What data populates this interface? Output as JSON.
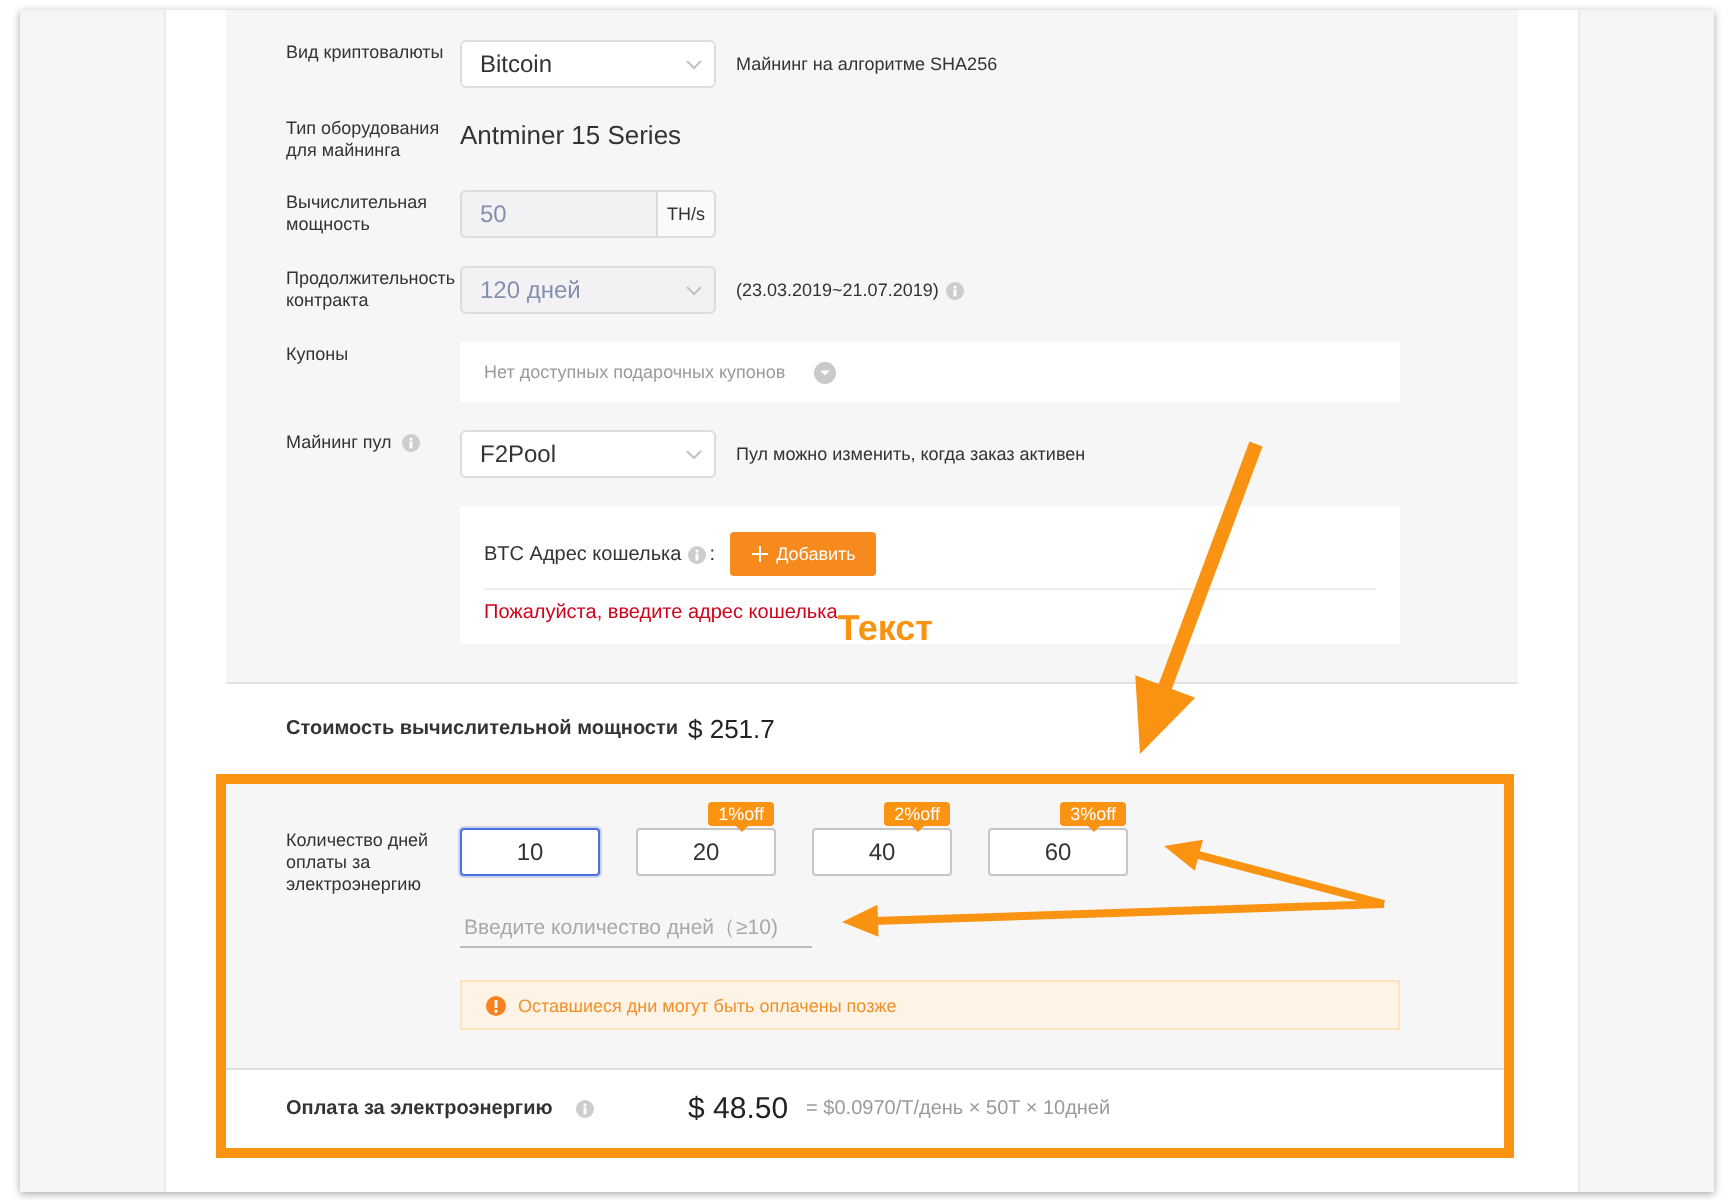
{
  "form_fields": [
    {
      "kind": "select",
      "label": "Вид криптовалюты",
      "value": "Bitcoin",
      "disabled": false,
      "note": "Майнинг на алгоритме SHA256"
    },
    {
      "kind": "text",
      "label": "Тип оборудования для майнинга",
      "value": "Antminer 15 Series"
    },
    {
      "kind": "unit_input",
      "label": "Вычислительная мощность",
      "value": "50",
      "unit": "TH/s",
      "disabled": true
    },
    {
      "kind": "select",
      "label": "Продолжительность контракта",
      "value": "120 дней",
      "disabled": true,
      "note": "(23.03.2019~21.07.2019)",
      "note_info": true
    },
    {
      "kind": "coupon",
      "label": "Купоны",
      "placeholder": "Нет доступных подарочных купонов"
    },
    {
      "kind": "select",
      "label": "Майнинг пул",
      "label_info": true,
      "value": "F2Pool",
      "disabled": false,
      "note": "Пул можно изменить, когда заказ активен"
    }
  ],
  "wallet": {
    "label": "BTC Адрес кошелька",
    "info": true,
    "separator": ":",
    "button": "Добавить",
    "error": "Пожалуйста, введите адрес кошелька"
  },
  "annotation": {
    "label": "Текст"
  },
  "compute_cost": {
    "label": "Стоимость вычислительной мощности",
    "value": "$ 251.7"
  },
  "electricity_days": {
    "label": "Количество дней оплаты за электроэнергию",
    "options": [
      {
        "value": "10",
        "selected": true
      },
      {
        "value": "20",
        "selected": false,
        "badge": "1%off"
      },
      {
        "value": "40",
        "selected": false,
        "badge": "2%off"
      },
      {
        "value": "60",
        "selected": false,
        "badge": "3%off"
      }
    ],
    "custom_days": {
      "placeholder": "Введите количество дней（≥10)"
    },
    "warning": "Оставшиеся дни могут быть оплачены позже"
  },
  "electricity_cost": {
    "label": "Оплата за электроэнергию",
    "info": true,
    "value": "$ 48.50",
    "formula": "= $0.0970/T/день × 50T × 10дней"
  }
}
